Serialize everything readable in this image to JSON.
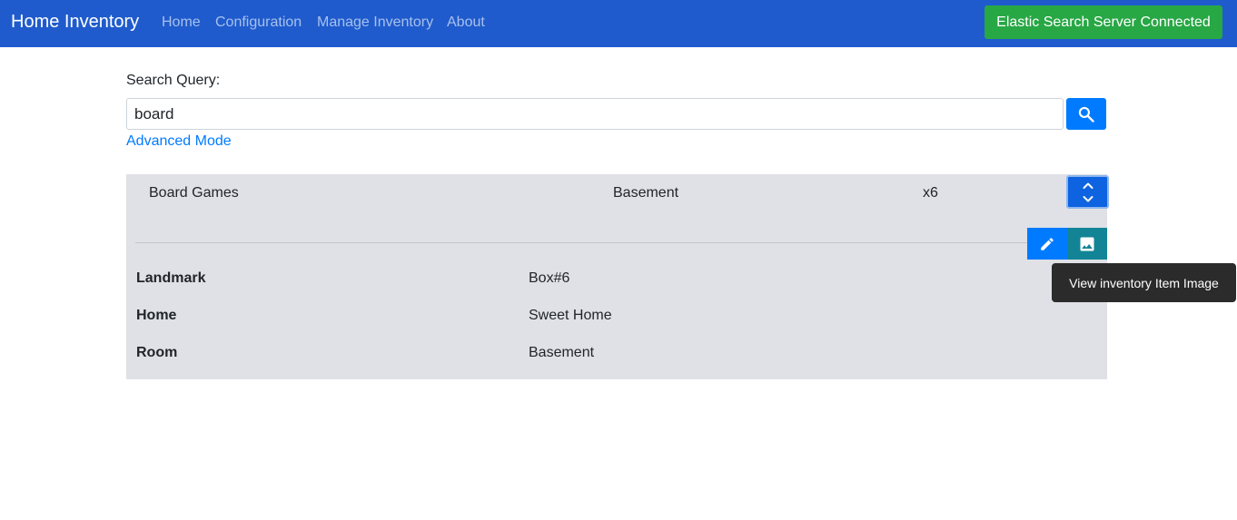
{
  "navbar": {
    "brand": "Home Inventory",
    "links": [
      "Home",
      "Configuration",
      "Manage Inventory",
      "About"
    ],
    "status": "Elastic Search Server Connected"
  },
  "search": {
    "label": "Search Query:",
    "value": "board",
    "advanced_link": "Advanced Mode",
    "button_icon": "search-icon"
  },
  "result": {
    "name": "Board Games",
    "location": "Basement",
    "quantity": "x6",
    "details": [
      {
        "label": "Landmark",
        "value": "Box#6"
      },
      {
        "label": "Home",
        "value": "Sweet Home"
      },
      {
        "label": "Room",
        "value": "Basement"
      }
    ],
    "actions": {
      "toggle_icon": "expand-collapse-icon",
      "edit_icon": "pencil-icon",
      "image_icon": "image-icon"
    }
  },
  "tooltip": "View inventory Item Image",
  "colors": {
    "navbar": "#1f5bcc",
    "primary": "#007bff",
    "success": "#28a745",
    "info": "#138496",
    "card": "#dfe1e6"
  }
}
